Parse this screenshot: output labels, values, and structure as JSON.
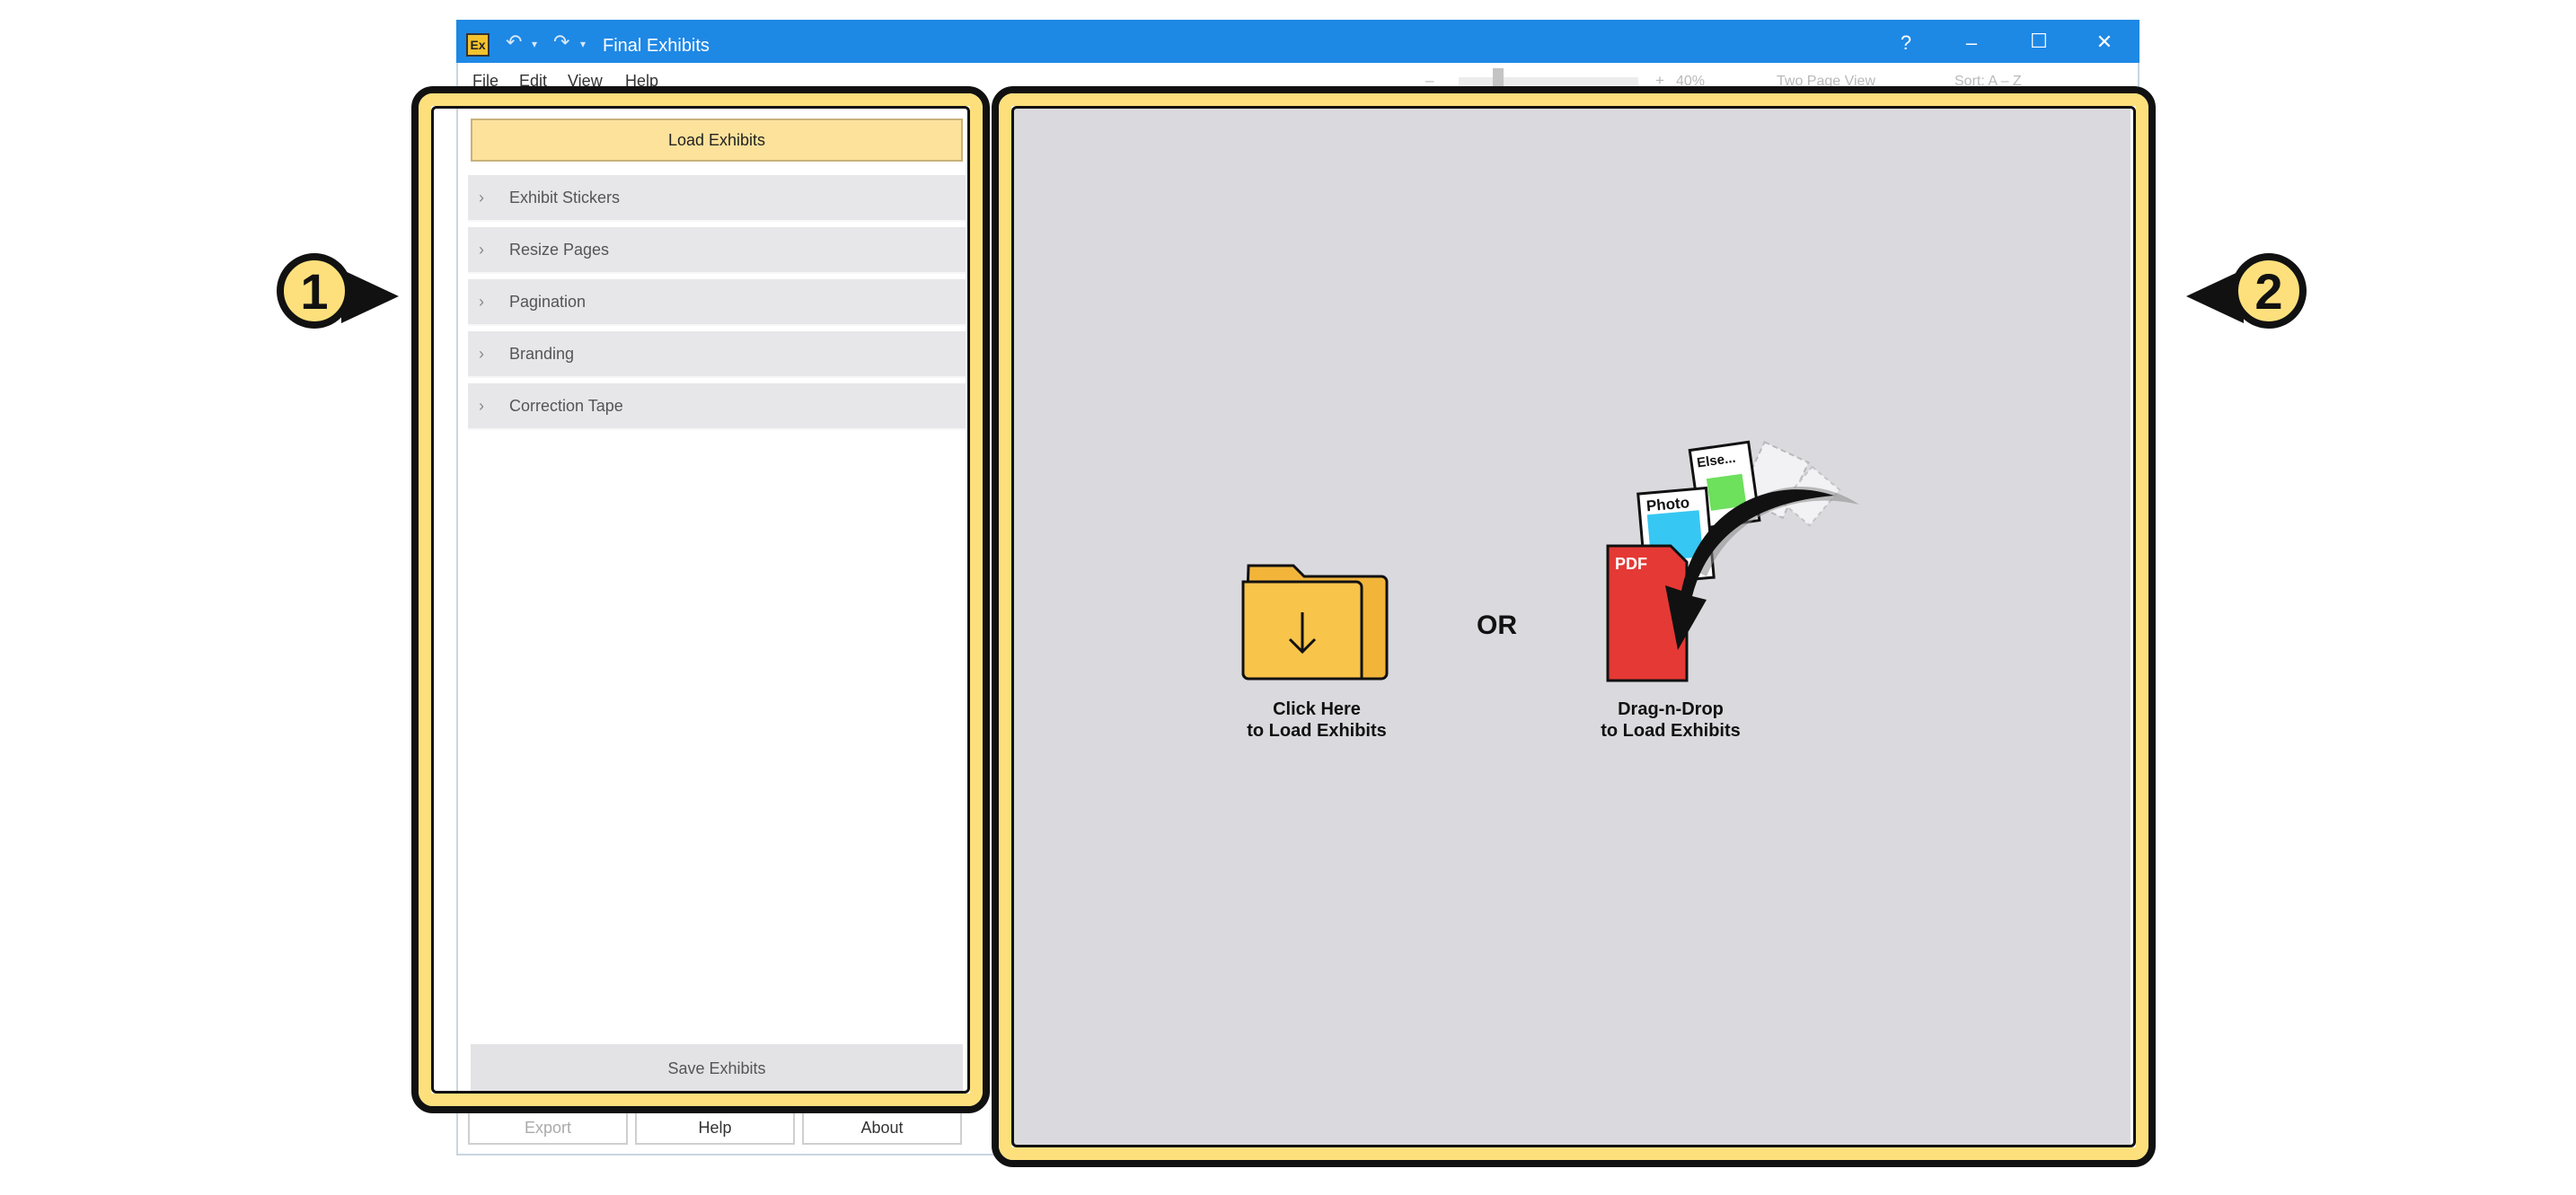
{
  "window": {
    "title": "Final Exhibits",
    "logo_text": "Ex",
    "quick_access": {
      "undo": "↶",
      "redo": "↷",
      "dropdown": "▾"
    },
    "controls": {
      "help": "?",
      "minimize": "–",
      "maximize": "☐",
      "close": "✕"
    }
  },
  "menu": {
    "items": [
      "File",
      "Edit",
      "View",
      "Help"
    ]
  },
  "toolbar": {
    "zoom_minus": "–",
    "zoom_plus": "+",
    "zoom_level": "40%",
    "zoom_fraction": 0.2,
    "view_mode": "Two Page View",
    "sort": "Sort: A – Z"
  },
  "left_panel": {
    "load_button": "Load Exhibits",
    "sections": [
      "Exhibit Stickers",
      "Resize Pages",
      "Pagination",
      "Branding",
      "Correction Tape"
    ],
    "save_button": "Save Exhibits",
    "bottom_buttons": [
      "Export",
      "Help",
      "About"
    ]
  },
  "drop_area": {
    "click_label_line1": "Click Here",
    "click_label_line2": "to Load Exhibits",
    "or_text": "OR",
    "drag_label_line1": "Drag-n-Drop",
    "drag_label_line2": "to Load Exhibits",
    "doc_labels": {
      "pdf": "PDF",
      "photo": "Photo",
      "else": "Else..."
    }
  },
  "callouts": {
    "left": "1",
    "right": "2"
  },
  "colors": {
    "title_bar": "#1e88e5",
    "highlight": "#fde07c",
    "load_button": "#fde29b",
    "drop_area": "#dadade",
    "folder": "#f8c44a",
    "pdf": "#e53935"
  }
}
